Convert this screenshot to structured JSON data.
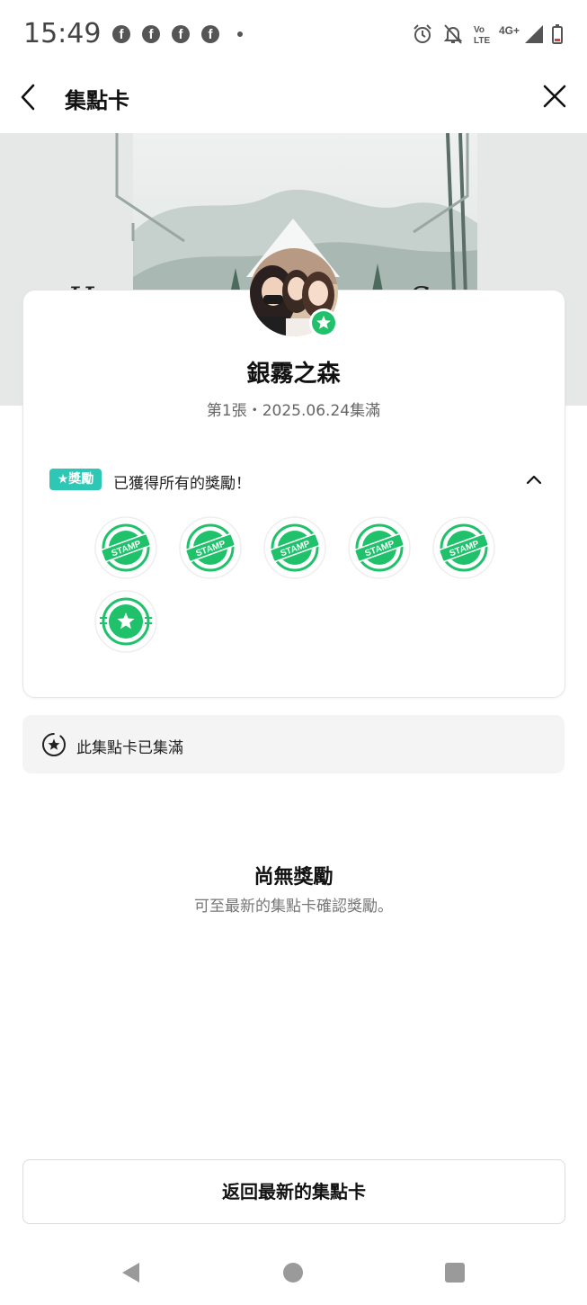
{
  "status_bar": {
    "time": "15:49",
    "notification_icons": [
      "facebook-icon",
      "facebook-icon",
      "facebook-icon",
      "facebook-icon",
      "more-dot-icon"
    ],
    "right_icons": [
      "alarm-icon",
      "mute-bell-icon",
      "volte-icon",
      "4g-plus-icon",
      "signal-icon",
      "battery-icon"
    ],
    "volte_label": "Vo LTE",
    "network_label": "4G+"
  },
  "app_bar": {
    "title": "集點卡",
    "back_icon": "chevron-left-icon",
    "close_icon": "close-icon"
  },
  "card": {
    "title": "銀霧之森",
    "subtitle": "第1張・2025.06.24集滿",
    "reward_tag": "★獎勵",
    "reward_text": "已獲得所有的獎勵！",
    "stamp_label": "STAMP",
    "stamps": [
      "stamp",
      "stamp",
      "stamp",
      "stamp",
      "stamp",
      "star"
    ]
  },
  "full_notice": {
    "text": "此集點卡已集滿"
  },
  "empty_state": {
    "title": "尚無獎勵",
    "subtitle": "可至最新的集點卡確認獎勵。"
  },
  "return_button": {
    "label": "返回最新的集點卡"
  },
  "colors": {
    "accent_green": "#1fc16b",
    "reward_tag": "#2ec6b4",
    "banner_bg": "#e6e8e8"
  }
}
